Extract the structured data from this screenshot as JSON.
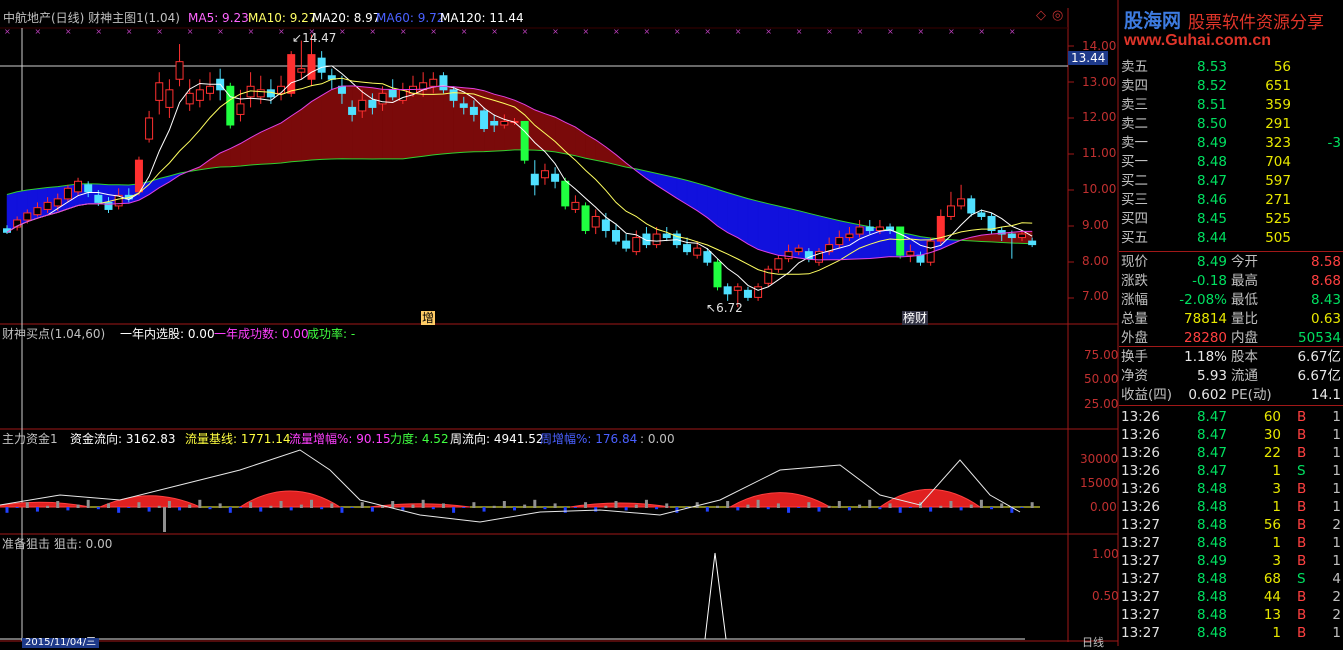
{
  "main_header": {
    "title": "中航地产(日线) 财神主图1(1.04)",
    "ma5": "MA5: 9.23",
    "ma10": "MA10: 9.27",
    "ma20": "MA20: 8.97",
    "ma60": "MA60: 9.72",
    "ma120": "MA120: 11.44"
  },
  "price_axis": [
    "14.00",
    "13.00",
    "12.00",
    "11.00",
    "10.00",
    "9.00",
    "8.00",
    "7.00"
  ],
  "crosshair_price": "13.44",
  "annotations": {
    "high": "14.47",
    "low": "6.72",
    "tag_zeng": "增",
    "tag_caishen": "榜财"
  },
  "panel2": {
    "title": "财神买点(1.04,60)",
    "text1": "一年内选股: 0.00",
    "text2": "一年成功数: 0.00",
    "text3": "成功率: -",
    "axis": [
      "75.00",
      "50.00",
      "25.00"
    ]
  },
  "panel3": {
    "title": "主力资金1",
    "t1": "资金流向: 3162.83",
    "t2": "流量基线: 1771.14",
    "t3": "流量增幅%: 90.15",
    "t4": "力度: 4.52",
    "t5": "周流向: 4941.52",
    "t6": "周增幅%: 176.84",
    "t7": ": 0.00",
    "axis": [
      "30000",
      "15000",
      "0.00"
    ]
  },
  "panel4": {
    "title": "准备狙击 狙击: 0.00",
    "axis": [
      "1.00",
      "0.50"
    ]
  },
  "bottom_date": "2015/11/04/三",
  "bottom_right": "日线",
  "watermark": {
    "logo": "股海网",
    "slogan": "股票软件资源分享",
    "url": "www.Guhai.com.cn"
  },
  "order_book": [
    {
      "label": "卖五",
      "price": "8.53",
      "vol": "56",
      "extra": ""
    },
    {
      "label": "卖四",
      "price": "8.52",
      "vol": "651",
      "extra": ""
    },
    {
      "label": "卖三",
      "price": "8.51",
      "vol": "359",
      "extra": ""
    },
    {
      "label": "卖二",
      "price": "8.50",
      "vol": "291",
      "extra": ""
    },
    {
      "label": "卖一",
      "price": "8.49",
      "vol": "323",
      "extra": "-3"
    },
    {
      "label": "买一",
      "price": "8.48",
      "vol": "704",
      "extra": ""
    },
    {
      "label": "买二",
      "price": "8.47",
      "vol": "597",
      "extra": ""
    },
    {
      "label": "买三",
      "price": "8.46",
      "vol": "271",
      "extra": ""
    },
    {
      "label": "买四",
      "price": "8.45",
      "vol": "525",
      "extra": ""
    },
    {
      "label": "买五",
      "price": "8.44",
      "vol": "505",
      "extra": ""
    }
  ],
  "quote_stats": [
    {
      "l1": "现价",
      "v1": "8.49",
      "c1": "#00e060",
      "l2": "今开",
      "v2": "8.58",
      "c2": "#ff4040"
    },
    {
      "l1": "涨跌",
      "v1": "-0.18",
      "c1": "#00e060",
      "l2": "最高",
      "v2": "8.68",
      "c2": "#ff4040"
    },
    {
      "l1": "涨幅",
      "v1": "-2.08%",
      "c1": "#00e060",
      "l2": "最低",
      "v2": "8.43",
      "c2": "#00e060"
    },
    {
      "l1": "总量",
      "v1": "78814",
      "c1": "#e8e800",
      "l2": "量比",
      "v2": "0.63",
      "c2": "#e8e800"
    },
    {
      "l1": "外盘",
      "v1": "28280",
      "c1": "#ff4040",
      "l2": "内盘",
      "v2": "50534",
      "c2": "#00e060"
    }
  ],
  "fund_stats": [
    {
      "l1": "换手",
      "v1": "1.18%",
      "l2": "股本",
      "v2": "6.67亿"
    },
    {
      "l1": "净资",
      "v1": "5.93",
      "l2": "流通",
      "v2": "6.67亿"
    },
    {
      "l1": "收益(四)",
      "v1": "0.602",
      "l2": "PE(动)",
      "v2": "14.1"
    }
  ],
  "ticks": [
    {
      "time": "13:26",
      "price": "8.47",
      "vol": "60",
      "side": "B",
      "n": "1"
    },
    {
      "time": "13:26",
      "price": "8.47",
      "vol": "30",
      "side": "B",
      "n": "1"
    },
    {
      "time": "13:26",
      "price": "8.47",
      "vol": "22",
      "side": "B",
      "n": "1"
    },
    {
      "time": "13:26",
      "price": "8.47",
      "vol": "1",
      "side": "S",
      "n": "1"
    },
    {
      "time": "13:26",
      "price": "8.48",
      "vol": "3",
      "side": "B",
      "n": "1"
    },
    {
      "time": "13:26",
      "price": "8.48",
      "vol": "1",
      "side": "B",
      "n": "1"
    },
    {
      "time": "13:27",
      "price": "8.48",
      "vol": "56",
      "side": "B",
      "n": "2"
    },
    {
      "time": "13:27",
      "price": "8.48",
      "vol": "1",
      "side": "B",
      "n": "1"
    },
    {
      "time": "13:27",
      "price": "8.49",
      "vol": "3",
      "side": "B",
      "n": "1"
    },
    {
      "time": "13:27",
      "price": "8.48",
      "vol": "68",
      "side": "S",
      "n": "4"
    },
    {
      "time": "13:27",
      "price": "8.48",
      "vol": "44",
      "side": "B",
      "n": "2"
    },
    {
      "time": "13:27",
      "price": "8.48",
      "vol": "13",
      "side": "B",
      "n": "2"
    },
    {
      "time": "13:27",
      "price": "8.48",
      "vol": "1",
      "side": "B",
      "n": "1"
    }
  ],
  "chart_data": {
    "type": "candlestick",
    "ylim": [
      6.3,
      14.6
    ],
    "candles": [
      [
        8.95,
        8.85,
        9.05,
        8.8
      ],
      [
        9.0,
        9.2,
        9.3,
        8.9
      ],
      [
        9.2,
        9.4,
        9.5,
        9.1
      ],
      [
        9.35,
        9.55,
        9.7,
        9.3
      ],
      [
        9.5,
        9.7,
        9.85,
        9.4
      ],
      [
        9.6,
        9.8,
        9.95,
        9.45
      ],
      [
        9.8,
        10.1,
        10.2,
        9.7
      ],
      [
        10.0,
        10.3,
        10.4,
        9.9
      ],
      [
        10.2,
        10.0,
        10.3,
        9.85
      ],
      [
        9.9,
        9.7,
        10.05,
        9.6
      ],
      [
        9.7,
        9.5,
        9.85,
        9.4
      ],
      [
        9.6,
        9.9,
        10.1,
        9.5
      ],
      [
        9.9,
        9.8,
        10.1,
        9.7
      ],
      [
        10.0,
        10.9,
        11.0,
        9.9
      ],
      [
        11.5,
        12.1,
        12.3,
        11.4
      ],
      [
        12.6,
        13.1,
        13.4,
        12.2
      ],
      [
        12.4,
        12.9,
        13.2,
        12.1
      ],
      [
        13.2,
        13.7,
        14.2,
        13.0
      ],
      [
        12.5,
        12.8,
        13.2,
        12.3
      ],
      [
        12.6,
        12.9,
        13.2,
        12.4
      ],
      [
        12.8,
        13.0,
        13.4,
        12.6
      ],
      [
        13.2,
        12.9,
        13.5,
        12.6
      ],
      [
        13.0,
        11.9,
        13.1,
        11.8
      ],
      [
        12.2,
        12.5,
        12.9,
        12.0
      ],
      [
        12.7,
        13.0,
        13.4,
        12.4
      ],
      [
        12.7,
        12.9,
        13.3,
        12.5
      ],
      [
        12.9,
        12.7,
        13.2,
        12.5
      ],
      [
        12.8,
        13.0,
        13.3,
        12.6
      ],
      [
        12.8,
        13.9,
        14.0,
        12.7
      ],
      [
        13.4,
        13.5,
        14.3,
        13.2
      ],
      [
        13.2,
        13.9,
        14.47,
        13.0
      ],
      [
        13.8,
        13.4,
        14.0,
        13.2
      ],
      [
        13.3,
        13.2,
        13.5,
        12.9
      ],
      [
        13.0,
        12.8,
        13.3,
        12.5
      ],
      [
        12.4,
        12.2,
        12.6,
        12.0
      ],
      [
        12.3,
        12.6,
        12.9,
        12.1
      ],
      [
        12.6,
        12.4,
        12.8,
        12.2
      ],
      [
        12.5,
        12.8,
        13.0,
        12.3
      ],
      [
        12.9,
        12.7,
        13.2,
        12.6
      ],
      [
        12.6,
        12.9,
        13.1,
        12.5
      ],
      [
        12.8,
        13.0,
        13.3,
        12.7
      ],
      [
        12.9,
        13.1,
        13.4,
        12.7
      ],
      [
        13.0,
        13.2,
        13.4,
        12.8
      ],
      [
        13.3,
        12.9,
        13.4,
        12.8
      ],
      [
        12.9,
        12.6,
        13.0,
        12.4
      ],
      [
        12.5,
        12.4,
        12.7,
        12.2
      ],
      [
        12.4,
        12.2,
        12.6,
        12.0
      ],
      [
        12.3,
        11.8,
        12.4,
        11.7
      ],
      [
        12.0,
        11.9,
        12.2,
        11.7
      ],
      [
        11.9,
        12.0,
        12.2,
        11.8
      ],
      [
        12.0,
        12.0,
        12.1,
        11.9
      ],
      [
        12.0,
        10.9,
        12.0,
        10.8
      ],
      [
        10.5,
        10.2,
        10.9,
        9.9
      ],
      [
        10.4,
        10.6,
        10.8,
        10.2
      ],
      [
        10.5,
        10.3,
        10.7,
        10.1
      ],
      [
        10.3,
        9.6,
        10.4,
        9.5
      ],
      [
        9.5,
        9.7,
        9.9,
        9.4
      ],
      [
        9.6,
        8.9,
        9.7,
        8.8
      ],
      [
        9.0,
        9.3,
        9.5,
        8.8
      ],
      [
        9.2,
        8.9,
        9.4,
        8.7
      ],
      [
        8.9,
        8.6,
        9.1,
        8.5
      ],
      [
        8.6,
        8.4,
        8.8,
        8.3
      ],
      [
        8.3,
        8.7,
        8.9,
        8.2
      ],
      [
        8.8,
        8.5,
        9.0,
        8.4
      ],
      [
        8.5,
        8.8,
        9.0,
        8.4
      ],
      [
        8.8,
        8.7,
        9.0,
        8.6
      ],
      [
        8.8,
        8.5,
        8.9,
        8.4
      ],
      [
        8.5,
        8.3,
        8.7,
        8.2
      ],
      [
        8.2,
        8.4,
        8.6,
        8.1
      ],
      [
        8.3,
        8.0,
        8.4,
        7.9
      ],
      [
        8.0,
        7.3,
        8.1,
        7.2
      ],
      [
        7.3,
        7.1,
        7.4,
        6.9
      ],
      [
        7.2,
        7.3,
        7.4,
        6.72
      ],
      [
        7.2,
        7.0,
        7.3,
        6.9
      ],
      [
        7.0,
        7.3,
        7.4,
        6.9
      ],
      [
        7.4,
        7.8,
        7.9,
        7.3
      ],
      [
        7.8,
        8.1,
        8.2,
        7.7
      ],
      [
        8.1,
        8.3,
        8.5,
        8.0
      ],
      [
        8.3,
        8.4,
        8.5,
        8.2
      ],
      [
        8.3,
        8.1,
        8.4,
        8.0
      ],
      [
        8.0,
        8.3,
        8.4,
        7.9
      ],
      [
        8.3,
        8.5,
        8.7,
        8.2
      ],
      [
        8.5,
        8.7,
        8.9,
        8.4
      ],
      [
        8.7,
        8.8,
        9.0,
        8.6
      ],
      [
        8.8,
        9.0,
        9.2,
        8.7
      ],
      [
        9.0,
        8.9,
        9.2,
        8.8
      ],
      [
        8.9,
        9.0,
        9.2,
        8.8
      ],
      [
        9.0,
        8.9,
        9.1,
        8.8
      ],
      [
        9.0,
        8.2,
        9.0,
        8.1
      ],
      [
        8.2,
        8.3,
        8.5,
        8.0
      ],
      [
        8.2,
        8.0,
        8.3,
        7.9
      ],
      [
        8.0,
        8.6,
        8.7,
        7.9
      ],
      [
        8.6,
        9.3,
        9.5,
        8.5
      ],
      [
        9.3,
        9.6,
        10.0,
        9.2
      ],
      [
        9.6,
        9.8,
        10.2,
        9.5
      ],
      [
        9.8,
        9.4,
        9.9,
        9.3
      ],
      [
        9.4,
        9.3,
        9.5,
        9.2
      ],
      [
        9.3,
        8.9,
        9.4,
        8.8
      ],
      [
        8.9,
        8.8,
        9.0,
        8.6
      ],
      [
        8.8,
        8.7,
        8.9,
        8.1
      ],
      [
        8.7,
        8.8,
        8.9,
        8.6
      ],
      [
        8.6,
        8.5,
        8.7,
        8.43
      ]
    ],
    "ma_lines": [
      "MA5",
      "MA10",
      "MA20",
      "MA60"
    ],
    "band_label": "财神主图1"
  }
}
